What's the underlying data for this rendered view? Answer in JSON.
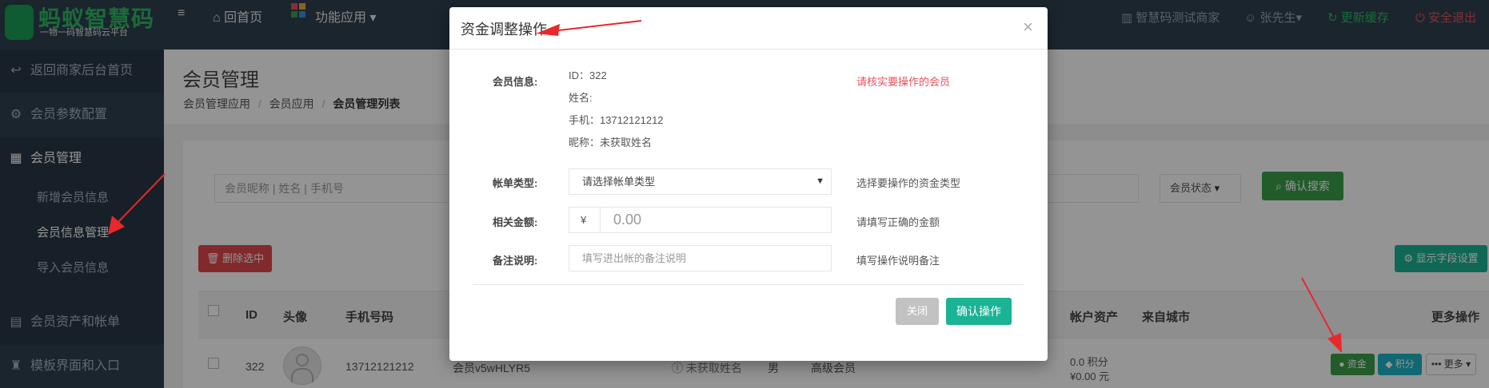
{
  "topbar": {
    "logo_title": "蚂蚁智慧码",
    "logo_subtitle": "一物一码智慧码云平台",
    "home": "回首页",
    "apps": "功能应用",
    "merchant": "智慧码测试商家",
    "user": "张先生",
    "refresh": "更新缓存",
    "logout": "安全退出"
  },
  "sidebar": {
    "items": [
      {
        "label": "返回商家后台首页",
        "icon": "back-icon"
      },
      {
        "label": "会员参数配置",
        "icon": "gear-icon"
      },
      {
        "label": "会员管理",
        "icon": "grid-icon"
      },
      {
        "label": "会员资产和帐单",
        "icon": "clipboard-icon"
      },
      {
        "label": "模板界面和入口",
        "icon": "shirt-icon"
      }
    ],
    "sub_items": [
      "新增会员信息",
      "会员信息管理",
      "导入会员信息"
    ]
  },
  "page": {
    "title": "会员管理",
    "breadcrumb": [
      "会员管理应用",
      "会员应用",
      "会员管理列表"
    ]
  },
  "search": {
    "placeholder": "会员昵称 | 姓名 | 手机号",
    "status_select": "会员状态",
    "search_button": "确认搜索"
  },
  "toolbar": {
    "delete_selected": "删除选中",
    "show_fields": "显示字段设置"
  },
  "table": {
    "headers": [
      "ID",
      "头像",
      "手机号码",
      "帐户资产",
      "来自城市",
      "更多操作"
    ],
    "row": {
      "id": "322",
      "phone": "13712121212",
      "nickname": "会员v5wHLYR5",
      "name": "未获取姓名",
      "gender": "男",
      "level": "高级会员",
      "points": "0.0 积分",
      "balance": "¥0.00 元",
      "btn_funds": "资金",
      "btn_points": "积分",
      "btn_more": "更多"
    }
  },
  "modal": {
    "title": "资金调整操作",
    "member_info_label": "会员信息:",
    "id_line": "ID：322",
    "name_line": "姓名:",
    "phone_line": "手机：13712121212",
    "nickname_line": "昵称：未获取姓名",
    "warning": "请核实要操作的会员",
    "bill_type_label": "帐单类型:",
    "bill_type_value": "请选择帐单类型",
    "bill_type_hint": "选择要操作的资金类型",
    "amount_label": "相关金额:",
    "currency": "¥",
    "amount_placeholder": "0.00",
    "amount_hint": "请填写正确的金额",
    "remark_label": "备注说明:",
    "remark_placeholder": "填写进出帐的备注说明",
    "remark_hint": "填写操作说明备注",
    "close_button": "关闭",
    "confirm_button": "确认操作"
  },
  "colors": {
    "sidebar_bg": "#2f4050",
    "primary_green": "#1ab394",
    "search_green": "#3c9f4a",
    "danger": "#e0474c",
    "warning_red": "#e8505b",
    "annotation_red": "#e8282b"
  }
}
